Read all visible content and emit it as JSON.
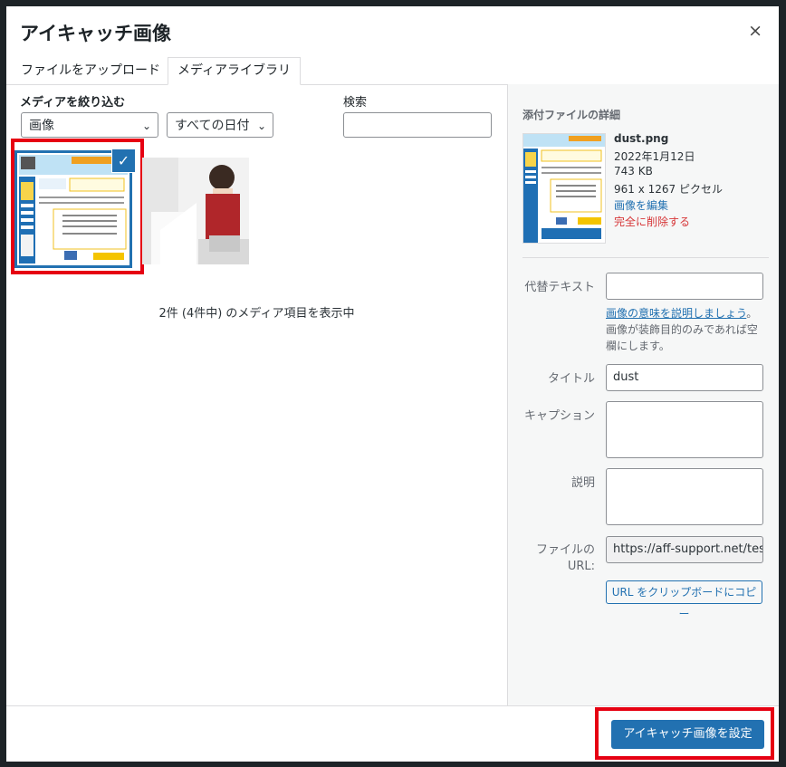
{
  "modal": {
    "title": "アイキャッチ画像",
    "close_icon": "×"
  },
  "tabs": [
    {
      "label": "ファイルをアップロード"
    },
    {
      "label": "メディアライブラリ"
    }
  ],
  "filters": {
    "label": "メディアを絞り込む",
    "type_select": "画像",
    "date_select": "すべての日付",
    "search_label": "検索",
    "search_value": ""
  },
  "grid": {
    "count_text": "2件 (4件中) のメディア項目を表示中",
    "checkmark": "✓"
  },
  "details": {
    "heading": "添付ファイルの詳細",
    "filename": "dust.png",
    "date": "2022年1月12日",
    "size": "743 KB",
    "dimensions": "961 x 1267 ピクセル",
    "edit_link": "画像を編集",
    "delete_link": "完全に削除する"
  },
  "fields": {
    "alt_label": "代替テキスト",
    "alt_value": "",
    "alt_help_link": "画像の意味を説明しましょう",
    "alt_help_rest": "。画像が装飾目的のみであれば空欄にします。",
    "title_label": "タイトル",
    "title_value": "dust",
    "caption_label": "キャプション",
    "caption_value": "",
    "desc_label": "説明",
    "desc_value": "",
    "url_label": "ファイルの URL:",
    "url_value": "https://aff-support.net/test/",
    "copy_button": "URL をクリップボードにコピー"
  },
  "footer": {
    "set_button": "アイキャッチ画像を設定"
  },
  "colors": {
    "accent": "#2271b1",
    "highlight": "#e60012",
    "delete": "#d63638"
  }
}
